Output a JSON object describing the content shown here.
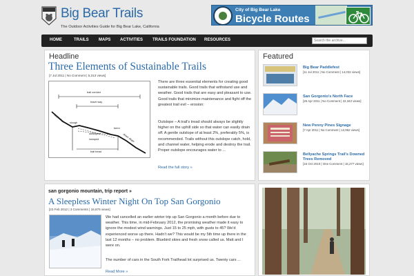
{
  "header": {
    "logo_text": "BIG BEAR TRAILS",
    "site_title": "Big Bear Trails",
    "tagline": "The Outdoor Activities Guide for Big Bear Lake, California"
  },
  "banner": {
    "small_text": "City of Big Bear Lake",
    "big_text": "Bicycle Routes"
  },
  "nav": {
    "items": [
      "HOME",
      "TRAILS",
      "MAPS",
      "ACTIVITIES",
      "TRAILS FOUNDATION",
      "RESOURCES"
    ],
    "search_placeholder": "Search the archive..."
  },
  "headline_section": {
    "label": "Headline",
    "title": "Three Elements of Sustainable Trails",
    "meta": "[7 Jul 2011 | No Comment | 5,313 views]",
    "body": "There are three essential elements for creating good sustainable trails. Good trails that withstand use and weather. Good trails that are easy and pleasant to use. Good trails that minimize maintenance and fight off the greatest trail evil – erosion:",
    "body2": "Outslope – A trail's tread should always be slightly higher on the uphill side so that water can easily drain off. A gentle outslope of at least 2%, preferably 5%, is recommended. Trails without this outslope catch, hold, and channel water, helping erode and destroy the trail. Proper outslope encourages water to ...",
    "read_more": "Read the full story »",
    "diagram_labels": {
      "corridor": "trail corridor",
      "tread_way": "travel way",
      "back_slope": "back slope",
      "slough": "slough",
      "berm": "berm",
      "down_slope": "down slope",
      "outsloped": "outsloped",
      "insloped": "insloped",
      "trail_tread": "trail tread"
    }
  },
  "second_post": {
    "category": "san gorgonio mountain, trip report »",
    "title": "A Sleepless Winter Night On Top San Gorgonio",
    "meta": "[23 Feb 2012 | 3 Comments | 16,876 views]",
    "body": "We had cancelled an earlier winter trip up San Gorgonio a month before due to weather. This time, in mid-February 2012, the promising weather made it easy to ignore the modest wind warnings. Just 15 to 25 mph, with gusts to 45? We'd experienced worse up there. Hadn't we? This would be my 5th time up there in the last 12 months – no problem. Bluebird skies and fresh snow called us. Matt and I were on.",
    "body2": "The number of cars in the South Fork Trailhead lot surprised us. Twenty cars ...",
    "read_more": "Read More »"
  },
  "featured": {
    "label": "Featured",
    "items": [
      {
        "title": "Big Bear Paddlefest",
        "meta": "[11 Jul 2011 | No Comment | 14,032 views]"
      },
      {
        "title": "San Gorgonio's North Face",
        "meta": "[26 Apr 2011 | No Comment | 22,342 views]"
      },
      {
        "title": "New Penny Pines Signage",
        "meta": "[7 Apr 2011 | No Comment | 12,962 views]"
      },
      {
        "title": "Bellyache Springs Trail's Downed Trees Removed",
        "meta": "[16 Oct 2010 | One Comment | 15,277 views]"
      }
    ]
  },
  "colors": {
    "link_blue": "#2a6aa8",
    "nav_bg": "#222222",
    "page_bg": "#e9e9e9"
  }
}
